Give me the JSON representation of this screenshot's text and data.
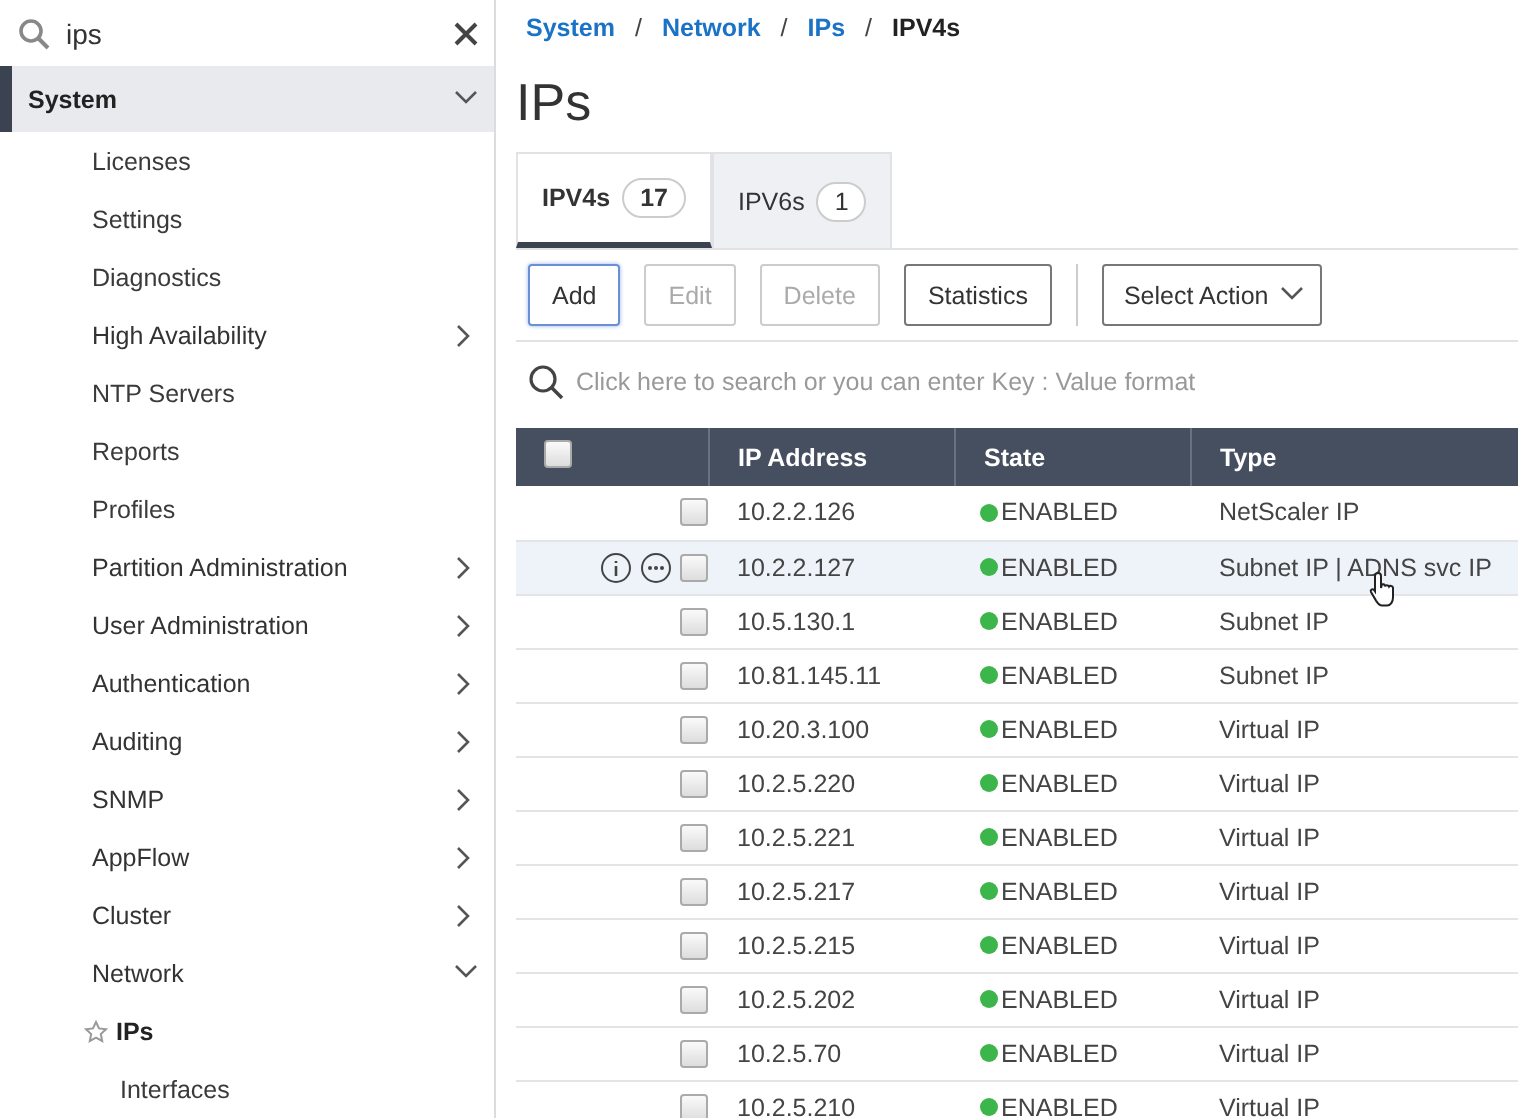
{
  "sidebar": {
    "search": {
      "value": "ips"
    },
    "items": [
      {
        "label": "System",
        "expanded": true,
        "selected": true,
        "children": [
          {
            "label": "Licenses",
            "kind": "leaf"
          },
          {
            "label": "Settings",
            "kind": "leaf"
          },
          {
            "label": "Diagnostics",
            "kind": "leaf"
          },
          {
            "label": "High Availability",
            "kind": "group",
            "expanded": false
          },
          {
            "label": "NTP Servers",
            "kind": "leaf"
          },
          {
            "label": "Reports",
            "kind": "leaf"
          },
          {
            "label": "Profiles",
            "kind": "leaf"
          },
          {
            "label": "Partition Administration",
            "kind": "group",
            "expanded": false
          },
          {
            "label": "User Administration",
            "kind": "group",
            "expanded": false
          },
          {
            "label": "Authentication",
            "kind": "group",
            "expanded": false
          },
          {
            "label": "Auditing",
            "kind": "group",
            "expanded": false
          },
          {
            "label": "SNMP",
            "kind": "group",
            "expanded": false
          },
          {
            "label": "AppFlow",
            "kind": "group",
            "expanded": false
          },
          {
            "label": "Cluster",
            "kind": "group",
            "expanded": false
          },
          {
            "label": "Network",
            "kind": "group",
            "expanded": true,
            "children": [
              {
                "label": "IPs",
                "kind": "leaf",
                "selected": true
              },
              {
                "label": "Interfaces",
                "kind": "leaf",
                "selected": false
              }
            ]
          }
        ]
      }
    ]
  },
  "breadcrumb": [
    {
      "label": "System",
      "link": true
    },
    {
      "separator": "/",
      "label": "Network",
      "link": true
    },
    {
      "separator": "/",
      "label": "IPs",
      "link": true
    },
    {
      "separator": "/",
      "label": "IPV4s",
      "link": false
    }
  ],
  "title": "IPs",
  "tabs": [
    {
      "label": "IPV4s",
      "count": "17",
      "selected": true
    },
    {
      "label": "IPV6s",
      "count": "1",
      "selected": false
    }
  ],
  "toolbar": {
    "buttons": [
      {
        "label": "Add",
        "disabled": false,
        "focused": true
      },
      {
        "label": "Edit",
        "disabled": true,
        "focused": false
      },
      {
        "label": "Delete",
        "disabled": true,
        "focused": false
      },
      {
        "label": "Statistics",
        "disabled": false,
        "focused": false
      }
    ],
    "action_select": "Select Action"
  },
  "search": {
    "placeholder": "Click here to search or you can enter Key : Value format"
  },
  "table": {
    "columns": [
      "IP Address",
      "State",
      "Type"
    ],
    "header_checked": false,
    "rows": [
      {
        "ip": "10.2.2.126",
        "state": "ENABLED",
        "type": "NetScaler IP",
        "checked": false,
        "hovered": false
      },
      {
        "ip": "10.2.2.127",
        "state": "ENABLED",
        "type": "Subnet IP | ADNS svc IP",
        "checked": false,
        "hovered": true
      },
      {
        "ip": "10.5.130.1",
        "state": "ENABLED",
        "type": "Subnet IP",
        "checked": false,
        "hovered": false
      },
      {
        "ip": "10.81.145.11",
        "state": "ENABLED",
        "type": "Subnet IP",
        "checked": false,
        "hovered": false
      },
      {
        "ip": "10.20.3.100",
        "state": "ENABLED",
        "type": "Virtual IP",
        "checked": false,
        "hovered": false
      },
      {
        "ip": "10.2.5.220",
        "state": "ENABLED",
        "type": "Virtual IP",
        "checked": false,
        "hovered": false
      },
      {
        "ip": "10.2.5.221",
        "state": "ENABLED",
        "type": "Virtual IP",
        "checked": false,
        "hovered": false
      },
      {
        "ip": "10.2.5.217",
        "state": "ENABLED",
        "type": "Virtual IP",
        "checked": false,
        "hovered": false
      },
      {
        "ip": "10.2.5.215",
        "state": "ENABLED",
        "type": "Virtual IP",
        "checked": false,
        "hovered": false
      },
      {
        "ip": "10.2.5.202",
        "state": "ENABLED",
        "type": "Virtual IP",
        "checked": false,
        "hovered": false
      },
      {
        "ip": "10.2.5.70",
        "state": "ENABLED",
        "type": "Virtual IP",
        "checked": false,
        "hovered": false
      },
      {
        "ip": "10.2.5.210",
        "state": "ENABLED",
        "type": "Virtual IP",
        "checked": false,
        "hovered": false
      }
    ]
  }
}
